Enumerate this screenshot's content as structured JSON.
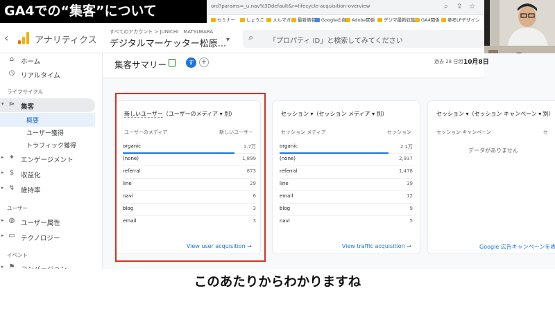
{
  "banner": {
    "title": "GA4での“集客”について"
  },
  "browser": {
    "url": "ord?params=_u.nav%3Ddefault&r=lifecycle-acquisition-overview",
    "bookmarks": [
      "セミナー",
      "しょうこ",
      "メルマガ",
      "最新情報",
      "Googleの自",
      "Adobe関係",
      "デジマ最新収集",
      "GA4関係",
      "参考LPデザイン"
    ]
  },
  "ga_header": {
    "app_name": "アナリティクス",
    "account_line": "すべてのアカウント > JUNICHI　MATSUBARA",
    "property_name": "デジタルマーケッター松原...",
    "search_placeholder": "「プロパティ ID」と検索してみてください"
  },
  "sidebar": {
    "home": "ホーム",
    "realtime": "リアルタイム",
    "lifecycle_section": "ライフサイクル",
    "acquisition": "集客",
    "overview": "概要",
    "user_acquisition": "ユーザー獲得",
    "traffic_acquisition": "トラフィック獲得",
    "engagement": "エンゲージメント",
    "monetization": "収益化",
    "retention": "維持率",
    "user_section": "ユーザー",
    "user_attributes": "ユーザー属性",
    "tech": "テクノロジー",
    "event_section": "イベント",
    "conversions": "コンバージョン"
  },
  "main": {
    "title": "集客サマリー",
    "avatar": "す",
    "date_label": "過去 28 日間",
    "date_value": "10月8日"
  },
  "cards": [
    {
      "title_metric": "新しいユーザー",
      "title_dim": "（ユーザーのメディア ▾ 別）",
      "col_dim": "ユーザーのメディア",
      "col_metric": "新しいユーザー",
      "rows": [
        {
          "k": "organic",
          "v": "1.7万",
          "pct": 0.84
        },
        {
          "k": "(none)",
          "v": "1,899"
        },
        {
          "k": "referral",
          "v": "873"
        },
        {
          "k": "line",
          "v": "29"
        },
        {
          "k": "navi",
          "v": "6"
        },
        {
          "k": "blog",
          "v": "3"
        },
        {
          "k": "email",
          "v": "3"
        }
      ],
      "link": "View user acquisition →"
    },
    {
      "title_metric": "セッション ▾",
      "title_dim": "（セッション メディア ▾ 別）",
      "col_dim": "セッション メディア",
      "col_metric": "セッション",
      "rows": [
        {
          "k": "organic",
          "v": "2.1万",
          "pct": 0.82
        },
        {
          "k": "(none)",
          "v": "2,937"
        },
        {
          "k": "referral",
          "v": "1,478"
        },
        {
          "k": "line",
          "v": "39"
        },
        {
          "k": "email",
          "v": "12"
        },
        {
          "k": "blog",
          "v": "9"
        },
        {
          "k": "navi",
          "v": "5"
        }
      ],
      "link": "View traffic acquisition →"
    },
    {
      "title_metric": "セッション ▾",
      "title_dim": "（セッション キャンペーン ▾ 別）",
      "col_dim": "セッション キャンペーン",
      "col_metric": "セ",
      "nodata": "データがありません",
      "link": "Google 広告キャンペーンを表"
    }
  ],
  "subtitle": "このあたりからわかりますね",
  "colors": {
    "accent": "#1a73e8",
    "highlight": "#d93025",
    "ga_orange": "#f9ab00",
    "ga_dark_orange": "#e37400"
  }
}
